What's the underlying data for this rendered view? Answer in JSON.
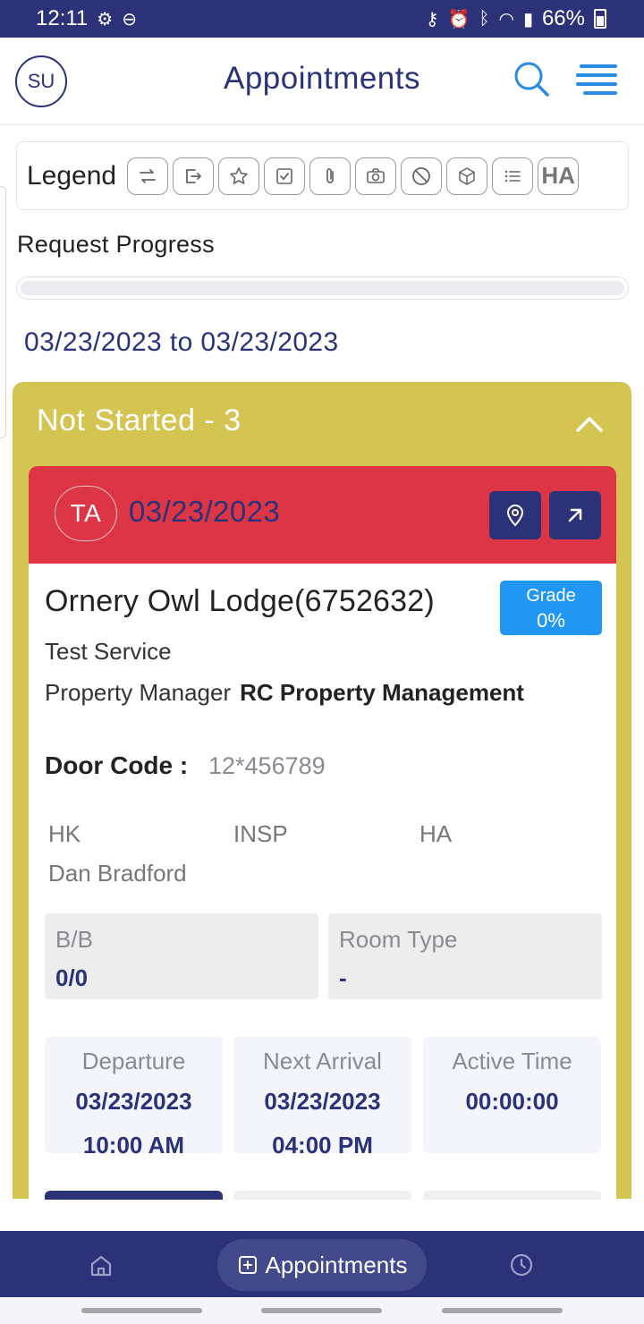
{
  "status_bar": {
    "time": "12:11",
    "battery": "66%"
  },
  "header": {
    "avatar_initials": "SU",
    "title": "Appointments"
  },
  "legend": {
    "label": "Legend",
    "items": [
      "swap-icon",
      "exit-icon",
      "star-icon",
      "checkbox-icon",
      "paperclip-icon",
      "camera-icon",
      "blocked-icon",
      "box-icon",
      "list-icon",
      "HA"
    ]
  },
  "request_progress": {
    "label": "Request Progress",
    "value": 0
  },
  "date_range": "03/23/2023 to 03/23/2023",
  "group": {
    "title": "Not Started - 3"
  },
  "card": {
    "badge": "TA",
    "date": "03/23/2023",
    "property_name": "Ornery Owl Lodge(6752632)",
    "grade_label": "Grade",
    "grade_value": "0%",
    "service": "Test Service",
    "pm_label": "Property Manager",
    "pm_value": "RC Property Management",
    "door_code_label": "Door Code :",
    "door_code_value": "12*456789",
    "roles": {
      "hk": "HK",
      "insp": "INSP",
      "ha": "HA",
      "hk_name": "Dan Bradford"
    },
    "bb_label": "B/B",
    "bb_value": "0/0",
    "room_type_label": "Room Type",
    "room_type_value": "-",
    "departure_label": "Departure",
    "departure_date": "03/23/2023",
    "departure_time": "10:00 AM",
    "next_arrival_label": "Next Arrival",
    "next_arrival_date": "03/23/2023",
    "next_arrival_time": "04:00 PM",
    "active_time_label": "Active Time",
    "active_time_value": "00:00:00"
  },
  "bottom_nav": {
    "active_label": "Appointments"
  },
  "colors": {
    "primary": "#2b3278",
    "accent_blue": "#2a8be0",
    "group_bg": "#d4c552",
    "card_header": "#dc3545",
    "grade_badge": "#2196f3"
  }
}
